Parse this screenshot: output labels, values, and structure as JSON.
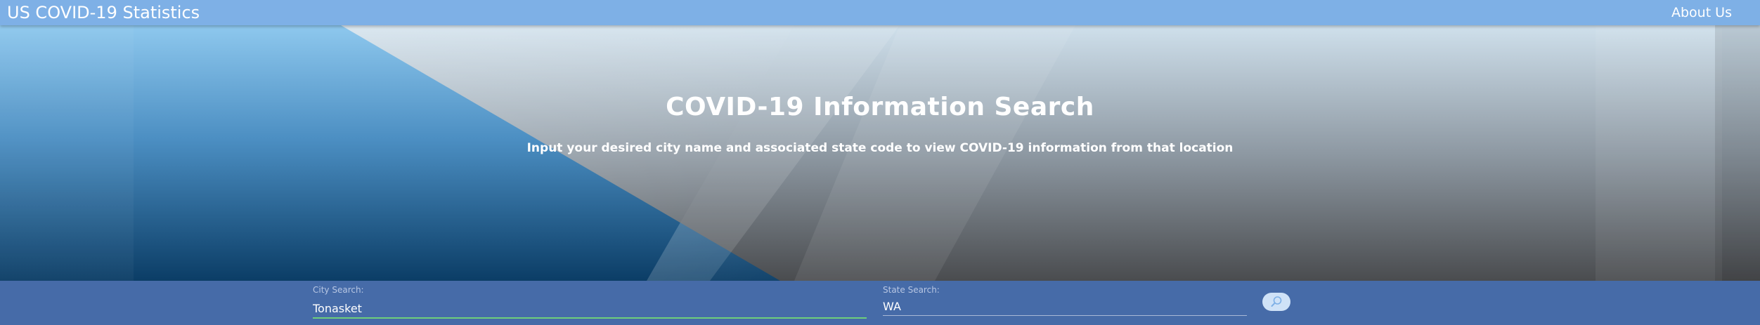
{
  "navbar": {
    "brand": "US COVID-19 Statistics",
    "about_label": "About Us"
  },
  "hero": {
    "title": "COVID-19 Information Search",
    "subtitle": "Input your desired city name and associated state code to view COVID-19 information from that location"
  },
  "search": {
    "city_label": "City Search:",
    "city_value": "Tonasket",
    "state_label": "State Search:",
    "state_value": "WA",
    "button_icon": "search-icon"
  },
  "colors": {
    "navbar": "#7eb0e6",
    "search_bar": "#466ba8",
    "active_underline": "#6fcf7a",
    "search_button": "#cfe2f7"
  }
}
